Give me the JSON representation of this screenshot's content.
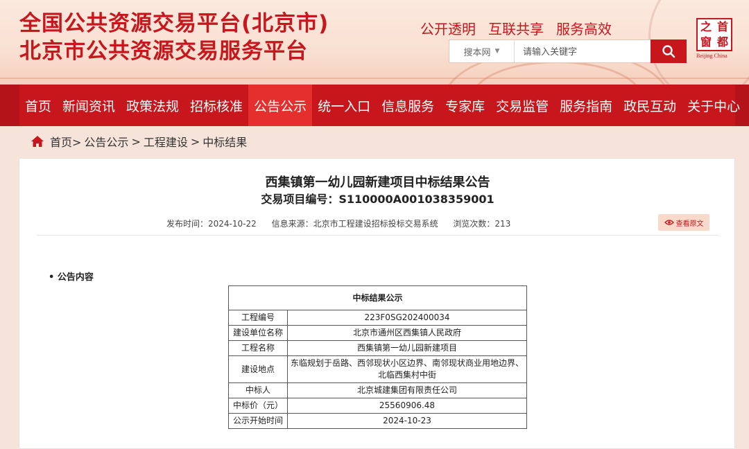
{
  "header": {
    "title_line1": "全国公共资源交易平台(北京市)",
    "title_line2": "北京市公共资源交易服务平台",
    "slogans": [
      "公开透明",
      "互联共享",
      "服务高效"
    ],
    "search": {
      "type_label": "搜本网",
      "placeholder": "请输入关键字"
    },
    "logo": {
      "chars": [
        "之",
        "首",
        "窗",
        "都"
      ],
      "en": "Beijing China"
    }
  },
  "nav": {
    "items": [
      "首页",
      "新闻资讯",
      "政策法规",
      "招标核准",
      "公告公示",
      "统一入口",
      "信息服务",
      "专家库",
      "交易监管",
      "服务指南",
      "政民互动",
      "关于中心"
    ],
    "active_index": 4
  },
  "breadcrumb": {
    "home": "首页>",
    "level1": "公告公示",
    "level2": "工程建设",
    "level3": "中标结果",
    "sep": ">"
  },
  "article": {
    "title": "西集镇第一幼儿园新建项目中标结果公告",
    "code_line": "交易项目编号：S110000A001038359001",
    "publish_time": "发布时间：2024-10-22",
    "source": "信息来源：北京市工程建设招标投标交易系统",
    "views": "浏览次数：213",
    "view_original": "查看原文",
    "section_title": "• 公告内容"
  },
  "result_table": {
    "caption": "中标结果公示",
    "rows": [
      {
        "key": "工程编号",
        "value": "223F0SG202400034"
      },
      {
        "key": "建设单位名称",
        "value": "北京市通州区西集镇人民政府"
      },
      {
        "key": "工程名称",
        "value": "西集镇第一幼儿园新建项目"
      },
      {
        "key": "建设地点",
        "value": "东临规划于岳路、西邻现状小区边界、南邻现状商业用地边界、北临西集村中街"
      },
      {
        "key": "中标人",
        "value": "北京城建集团有限责任公司"
      },
      {
        "key": "中标价（元）",
        "value": "25560906.48"
      },
      {
        "key": "公示开始时间",
        "value": "2024-10-23"
      }
    ]
  },
  "colors": {
    "brand_red": "#c8161d",
    "nav_active": "#e52e2e",
    "page_bg": "#f6e4da"
  }
}
